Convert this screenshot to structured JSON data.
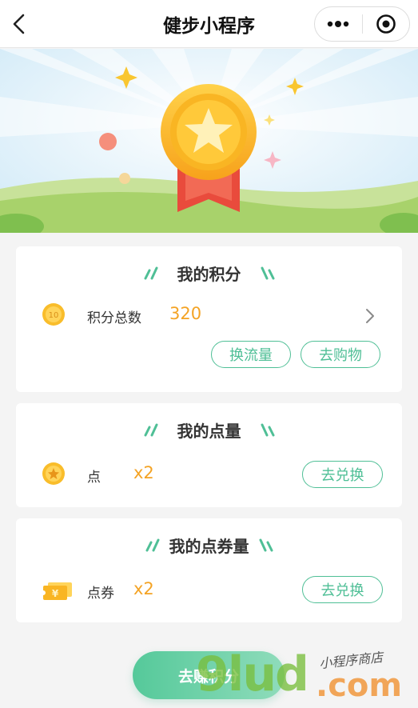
{
  "navbar": {
    "title": "健步小程序"
  },
  "points_card": {
    "title": "我的积分",
    "total_label": "积分总数",
    "total_value": "320",
    "coin_text": "10",
    "buttons": [
      "换流量",
      "去购物"
    ]
  },
  "dots_card": {
    "title": "我的点量",
    "label": "点",
    "value": "x2",
    "button": "去兑换"
  },
  "vouchers_card": {
    "title": "我的点券量",
    "label": "点券",
    "value": "x2",
    "button": "去兑换",
    "voucher_symbol": "¥"
  },
  "cta": {
    "label": "去赚积分"
  },
  "watermark": {
    "brand": "9lud",
    "domain": ".com",
    "tagline": "小程序商店"
  },
  "colors": {
    "accent_green": "#4fbf96",
    "value_orange": "#f4a324",
    "banner_sky": "#cfe9f7",
    "grass": "#a8d26b"
  }
}
